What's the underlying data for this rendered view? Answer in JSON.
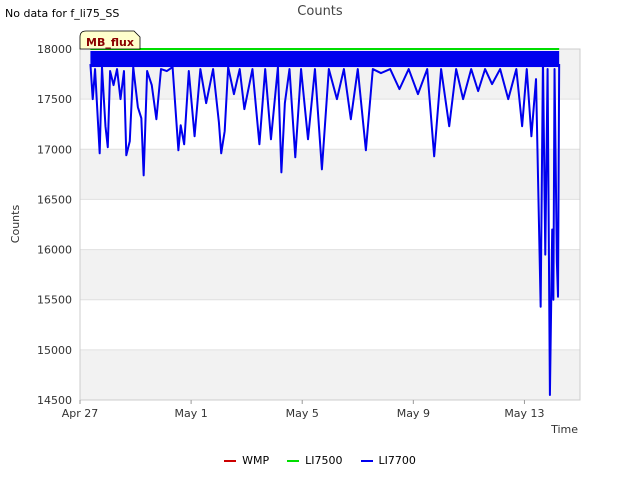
{
  "header": {
    "no_data_text": "No data for f_li75_SS"
  },
  "chart_data": {
    "type": "line",
    "title": "Counts",
    "xlabel": "Time",
    "ylabel": "Counts",
    "ylim": [
      14500,
      18000
    ],
    "yticks": [
      14500,
      15000,
      15500,
      16000,
      16500,
      17000,
      17500,
      18000
    ],
    "xlim": [
      "2025-04-27",
      "2025-05-15"
    ],
    "xticks": [
      {
        "date": "2025-04-27",
        "label": "Apr 27"
      },
      {
        "date": "2025-05-01",
        "label": "May 1"
      },
      {
        "date": "2025-05-05",
        "label": "May 5"
      },
      {
        "date": "2025-05-09",
        "label": "May 9"
      },
      {
        "date": "2025-05-13",
        "label": "May 13"
      }
    ],
    "annotation": "MB_flux",
    "legend_position": "bottom",
    "series": [
      {
        "name": "WMP",
        "color": "#cc0000",
        "points": []
      },
      {
        "name": "LI7500",
        "color": "#00dd00",
        "points": [
          [
            "2025-04-27T09:00",
            18000
          ],
          [
            "2025-05-14T06:00",
            18000
          ]
        ]
      },
      {
        "name": "LI7700",
        "color": "#0000ee",
        "points": [
          [
            "2025-04-27T09:00",
            17850
          ],
          [
            "2025-04-27T11:00",
            17500
          ],
          [
            "2025-04-27T13:00",
            17800
          ],
          [
            "2025-04-27T17:00",
            16960
          ],
          [
            "2025-04-27T19:00",
            17820
          ],
          [
            "2025-04-27T22:00",
            17230
          ],
          [
            "2025-04-28T00:00",
            17020
          ],
          [
            "2025-04-28T02:00",
            17780
          ],
          [
            "2025-04-28T05:00",
            17640
          ],
          [
            "2025-04-28T08:00",
            17800
          ],
          [
            "2025-04-28T11:00",
            17500
          ],
          [
            "2025-04-28T14:00",
            17780
          ],
          [
            "2025-04-28T16:00",
            16940
          ],
          [
            "2025-04-28T19:00",
            17080
          ],
          [
            "2025-04-28T22:00",
            17820
          ],
          [
            "2025-04-29T02:00",
            17420
          ],
          [
            "2025-04-29T05:00",
            17310
          ],
          [
            "2025-04-29T07:00",
            16740
          ],
          [
            "2025-04-29T10:00",
            17780
          ],
          [
            "2025-04-29T14:00",
            17640
          ],
          [
            "2025-04-29T18:00",
            17300
          ],
          [
            "2025-04-29T22:00",
            17800
          ],
          [
            "2025-04-30T03:00",
            17780
          ],
          [
            "2025-04-30T08:00",
            17820
          ],
          [
            "2025-04-30T13:00",
            16990
          ],
          [
            "2025-04-30T15:00",
            17240
          ],
          [
            "2025-04-30T18:00",
            17050
          ],
          [
            "2025-04-30T22:00",
            17780
          ],
          [
            "2025-05-01T03:00",
            17130
          ],
          [
            "2025-05-01T08:00",
            17800
          ],
          [
            "2025-05-01T13:00",
            17460
          ],
          [
            "2025-05-01T19:00",
            17800
          ],
          [
            "2025-05-02T00:00",
            17270
          ],
          [
            "2025-05-02T02:00",
            16960
          ],
          [
            "2025-05-02T05:00",
            17180
          ],
          [
            "2025-05-02T08:00",
            17820
          ],
          [
            "2025-05-02T13:00",
            17550
          ],
          [
            "2025-05-02T18:00",
            17800
          ],
          [
            "2025-05-02T22:00",
            17400
          ],
          [
            "2025-05-03T05:00",
            17800
          ],
          [
            "2025-05-03T11:00",
            17050
          ],
          [
            "2025-05-03T16:00",
            17800
          ],
          [
            "2025-05-03T21:00",
            17100
          ],
          [
            "2025-05-04T03:00",
            17820
          ],
          [
            "2025-05-04T06:00",
            16770
          ],
          [
            "2025-05-04T09:00",
            17460
          ],
          [
            "2025-05-04T13:00",
            17800
          ],
          [
            "2025-05-04T18:00",
            16920
          ],
          [
            "2025-05-04T23:00",
            17800
          ],
          [
            "2025-05-05T05:00",
            17100
          ],
          [
            "2025-05-05T11:00",
            17800
          ],
          [
            "2025-05-05T17:00",
            16800
          ],
          [
            "2025-05-05T23:00",
            17800
          ],
          [
            "2025-05-06T06:00",
            17500
          ],
          [
            "2025-05-06T12:00",
            17800
          ],
          [
            "2025-05-06T18:00",
            17300
          ],
          [
            "2025-05-07T00:00",
            17800
          ],
          [
            "2025-05-07T07:00",
            16990
          ],
          [
            "2025-05-07T13:00",
            17800
          ],
          [
            "2025-05-07T20:00",
            17760
          ],
          [
            "2025-05-08T04:00",
            17800
          ],
          [
            "2025-05-08T12:00",
            17600
          ],
          [
            "2025-05-08T20:00",
            17800
          ],
          [
            "2025-05-09T04:00",
            17550
          ],
          [
            "2025-05-09T12:00",
            17800
          ],
          [
            "2025-05-09T18:00",
            16930
          ],
          [
            "2025-05-10T00:00",
            17800
          ],
          [
            "2025-05-10T07:00",
            17230
          ],
          [
            "2025-05-10T13:00",
            17800
          ],
          [
            "2025-05-10T19:00",
            17500
          ],
          [
            "2025-05-11T02:00",
            17800
          ],
          [
            "2025-05-11T08:00",
            17580
          ],
          [
            "2025-05-11T14:00",
            17800
          ],
          [
            "2025-05-11T20:00",
            17650
          ],
          [
            "2025-05-12T03:00",
            17800
          ],
          [
            "2025-05-12T10:00",
            17500
          ],
          [
            "2025-05-12T17:00",
            17800
          ],
          [
            "2025-05-12T22:00",
            17230
          ],
          [
            "2025-05-13T02:00",
            17800
          ],
          [
            "2025-05-13T06:00",
            17130
          ],
          [
            "2025-05-13T10:00",
            17700
          ],
          [
            "2025-05-13T14:00",
            15430
          ],
          [
            "2025-05-13T16:00",
            17900
          ],
          [
            "2025-05-13T18:00",
            15950
          ],
          [
            "2025-05-13T20:00",
            17800
          ],
          [
            "2025-05-13T22:00",
            14550
          ],
          [
            "2025-05-14T00:00",
            16200
          ],
          [
            "2025-05-14T01:00",
            15500
          ],
          [
            "2025-05-14T02:00",
            17800
          ],
          [
            "2025-05-14T04:00",
            15880
          ],
          [
            "2025-05-14T05:00",
            15530
          ],
          [
            "2025-05-14T06:00",
            17850
          ]
        ]
      }
    ]
  }
}
